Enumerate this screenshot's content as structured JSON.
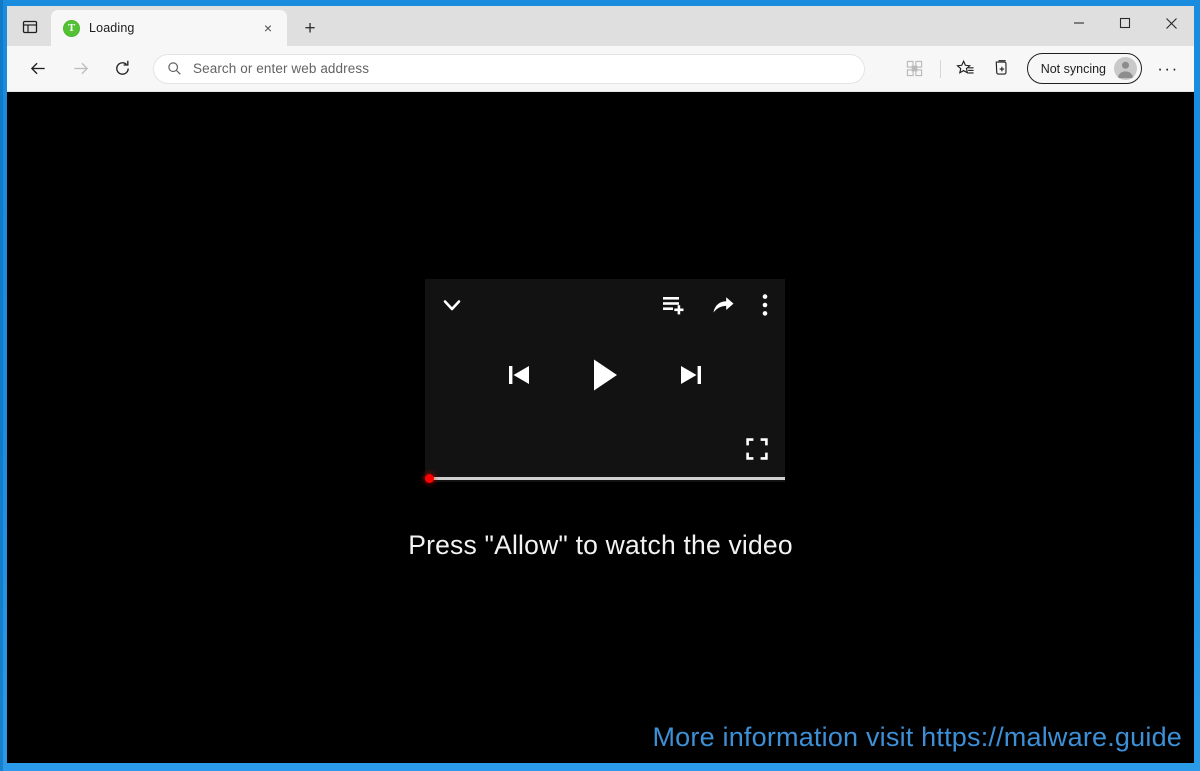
{
  "window": {
    "controls": {
      "minimize_label": "Minimize",
      "maximize_label": "Maximize",
      "close_label": "Close"
    }
  },
  "tabstrip": {
    "tab_actions_label": "Tab actions",
    "new_tab_label": "+",
    "tabs": [
      {
        "title": "Loading",
        "favicon": "green-circle-t-icon",
        "favicon_letter": "T",
        "favicon_color": "#52c234",
        "close_label": "×",
        "active": true
      }
    ]
  },
  "toolbar": {
    "back_label": "Back",
    "forward_label": "Forward",
    "refresh_label": "Refresh",
    "address": {
      "value": "",
      "placeholder": "Search or enter web address",
      "icon": "search-icon"
    },
    "icons": [
      {
        "name": "split-screen-icon",
        "label": "Split screen",
        "faded": true
      },
      {
        "name": "favorites-icon",
        "label": "Favorites"
      },
      {
        "name": "collections-icon",
        "label": "Collections"
      }
    ],
    "profile": {
      "label": "Not syncing",
      "avatar": "account-avatar-icon"
    },
    "settings_label": "···"
  },
  "page": {
    "background_color": "#000000",
    "player": {
      "collapse_label": "Collapse",
      "queue_label": "Add to queue",
      "share_label": "Share",
      "menu_label": "More options",
      "previous_label": "Previous",
      "play_label": "Play",
      "next_label": "Next",
      "fullscreen_label": "Fullscreen",
      "progress_percent": 0,
      "accent_color": "#ff0000",
      "panel_color": "#121212"
    },
    "message": "Press \"Allow\" to watch the video",
    "watermark": {
      "text": "More information visit https://malware.guide",
      "color": "#3d8fd6"
    }
  }
}
